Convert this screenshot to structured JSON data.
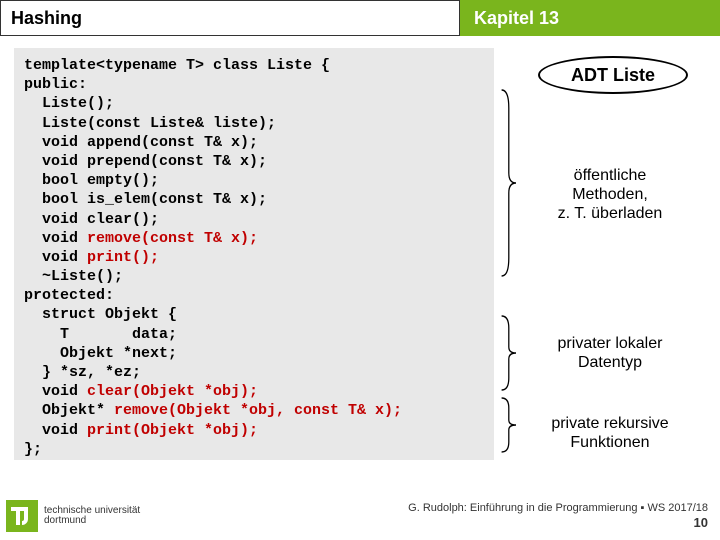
{
  "header": {
    "left": "Hashing",
    "right": "Kapitel 13"
  },
  "code": {
    "l01": "template<typename T> class Liste {",
    "l02": "public:",
    "l03": "  Liste();",
    "l04": "  Liste(const Liste& liste);",
    "l05": "  void append(const T& x);",
    "l06": "  void prepend(const T& x);",
    "l07": "  bool empty();",
    "l08": "  bool is_elem(const T& x);",
    "l09": "  void clear();",
    "l10a": "  void ",
    "l10b": "remove(const T& x);",
    "l11a": "  void ",
    "l11b": "print();",
    "l12": "  ~Liste();",
    "l13": "protected:",
    "l14": "  struct Objekt {",
    "l15": "    T       data;",
    "l16": "    Objekt *next;",
    "l17": "  } *sz, *ez;",
    "l18a": "  void ",
    "l18b": "clear(Objekt *obj);",
    "l19a": "  Objekt* ",
    "l19b": "remove(Objekt *obj, const T& x);",
    "l20a": "  void ",
    "l20b": "print(Objekt *obj);",
    "l21": "};"
  },
  "annotations": {
    "adt": "ADT Liste",
    "a1_l1": "öffentliche",
    "a1_l2": "Methoden,",
    "a1_l3": "z. T. überladen",
    "a2_l1": "privater lokaler",
    "a2_l2": "Datentyp",
    "a3_l1": "private rekursive",
    "a3_l2": "Funktionen"
  },
  "footer": {
    "uni1": "technische universität",
    "uni2": "dortmund",
    "credit": "G. Rudolph: Einführung in die Programmierung ▪ WS 2017/18",
    "page": "10"
  },
  "colors": {
    "accent": "#7ab51d",
    "codebg": "#e8e8e8",
    "emph": "#c00000"
  }
}
